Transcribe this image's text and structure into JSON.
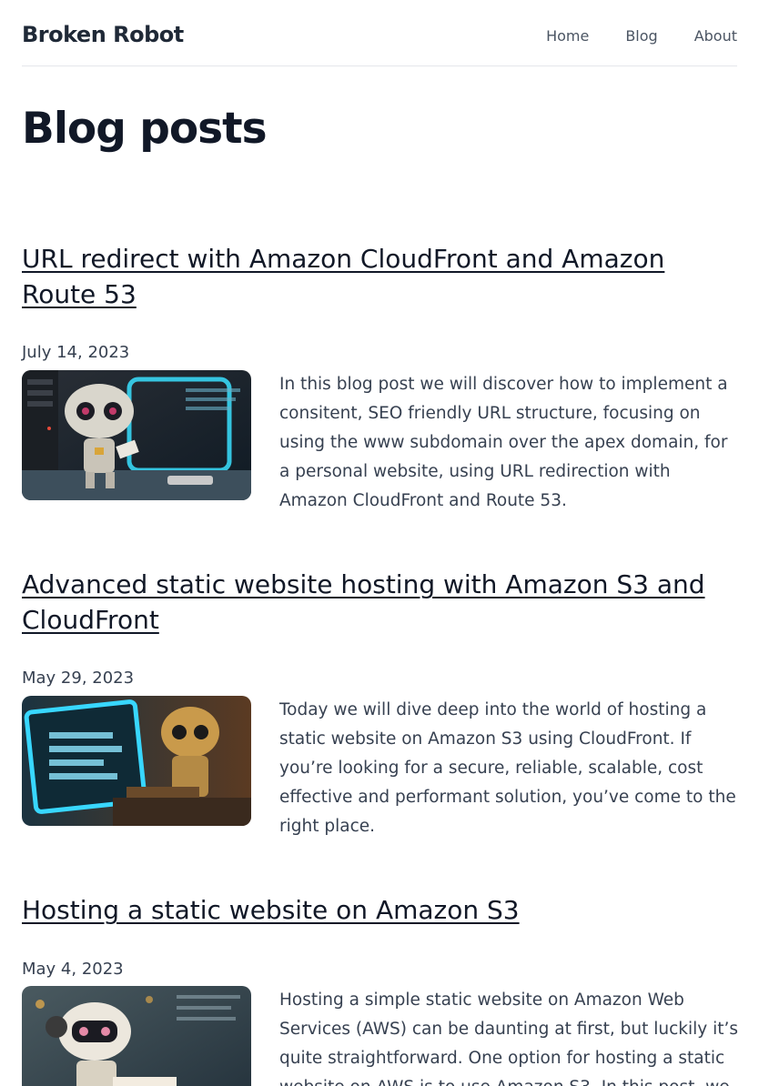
{
  "site": {
    "title": "Broken Robot"
  },
  "nav": [
    {
      "label": "Home"
    },
    {
      "label": "Blog"
    },
    {
      "label": "About"
    }
  ],
  "page": {
    "title": "Blog posts"
  },
  "posts": [
    {
      "title": "URL redirect with Amazon CloudFront and Amazon Route 53",
      "date": "July 14, 2023",
      "excerpt": "In this blog post we will discover how to implement a consitent, SEO friendly URL structure, focusing on using the www subdomain over the apex domain, for a personal website, using URL redirection with Amazon CloudFront and Route 53."
    },
    {
      "title": "Advanced static website hosting with Amazon S3 and CloudFront",
      "date": "May 29, 2023",
      "excerpt": "Today we will dive deep into the world of hosting a static website on Amazon S3 using CloudFront. If you’re looking for a secure, reliable, scalable, cost effective and performant solution, you’ve come to the right place."
    },
    {
      "title": "Hosting a static website on Amazon S3",
      "date": "May 4, 2023",
      "excerpt": "Hosting a simple static website on Amazon Web Services (AWS) can be daunting at first, but luckily it’s quite straightforward. One option for hosting a static website on AWS is to use Amazon S3. In this post, we"
    }
  ],
  "colors": {
    "heading": "#111827",
    "body_text": "#374151",
    "nav_text": "#4b5563",
    "divider": "#e5e7eb"
  }
}
